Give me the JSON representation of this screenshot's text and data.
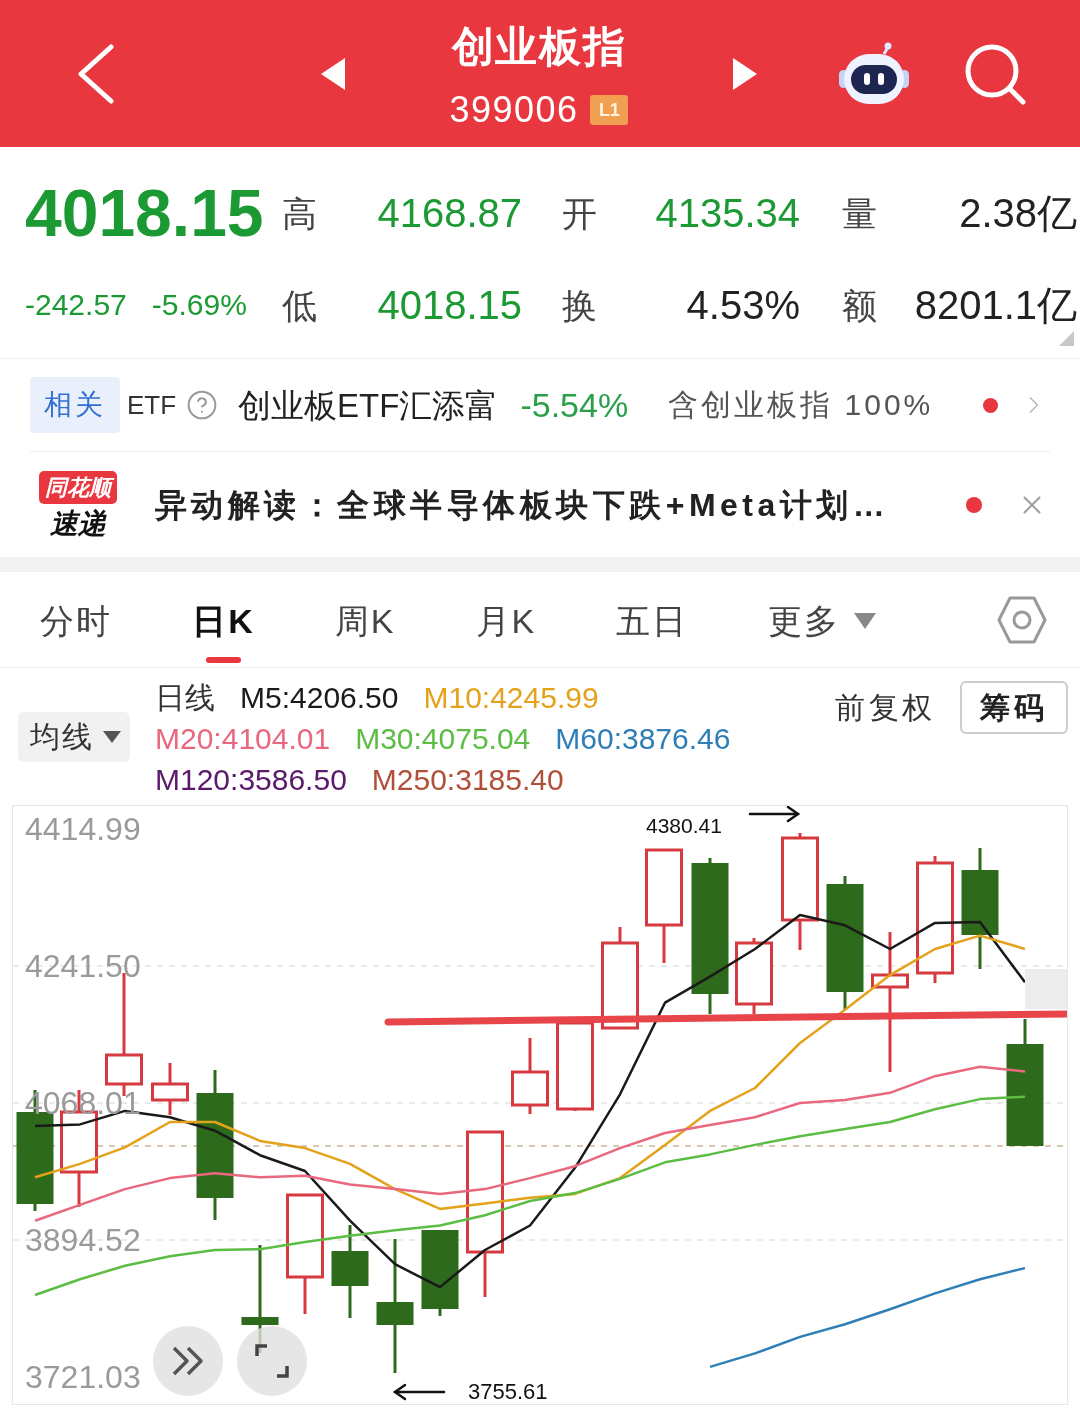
{
  "header": {
    "title": "创业板指",
    "code": "399006",
    "level_badge": "L1"
  },
  "quote": {
    "falling": true,
    "price": "4018.15",
    "change": "-242.57",
    "change_percent": "-5.69%",
    "stats": [
      {
        "label": "高",
        "value": "4168.87",
        "color": "#1b9a33"
      },
      {
        "label": "开",
        "value": "4135.34",
        "color": "#1b9a33"
      },
      {
        "label": "量",
        "value": "2.38亿",
        "color": "#222222"
      },
      {
        "label": "低",
        "value": "4018.15",
        "color": "#1b9a33"
      },
      {
        "label": "换",
        "value": "4.53%",
        "color": "#222222"
      },
      {
        "label": "额",
        "value": "8201.1亿",
        "color": "#222222"
      }
    ]
  },
  "etf": {
    "tag": "相关",
    "label": "ETF",
    "fund": "创业板ETF汇添富",
    "fund_change": "-5.54%",
    "fund_falling": true,
    "holding": "含创业板指 100%",
    "new": true
  },
  "news": {
    "logo_top": "同花顺",
    "logo_bottom": "速递",
    "text": "异动解读：全球半导体板块下跌+Meta计划…",
    "new": true
  },
  "tabs": [
    {
      "label": "分时",
      "selected": false,
      "kind": "tab"
    },
    {
      "label": "日K",
      "selected": true,
      "kind": "tab"
    },
    {
      "label": "周K",
      "selected": false,
      "kind": "tab"
    },
    {
      "label": "月K",
      "selected": false,
      "kind": "tab"
    },
    {
      "label": "五日",
      "selected": false,
      "kind": "tab"
    },
    {
      "label": "更多",
      "selected": false,
      "kind": "dropdown"
    }
  ],
  "indicator": {
    "button": "均线",
    "period": "日线",
    "rows": [
      [
        {
          "label": "M5:4206.50",
          "color": "#1a1a1a"
        },
        {
          "label": "M10:4245.99",
          "color": "#e3a21a"
        }
      ],
      [
        {
          "label": "M20:4104.01",
          "color": "#e8687f"
        },
        {
          "label": "M30:4075.04",
          "color": "#5cbd45"
        },
        {
          "label": "M60:3876.46",
          "color": "#2f7fb6"
        }
      ],
      [
        {
          "label": "M120:3586.50",
          "color": "#5a1a6a"
        },
        {
          "label": "M250:3185.40",
          "color": "#b0503a"
        }
      ]
    ],
    "adjust": "前复权",
    "chips_button": "筹码"
  },
  "chart": {
    "high_label": "4380.41",
    "low_label": "3755.61",
    "chart_data": {
      "type": "line",
      "ylim": [
        3687,
        4444
      ],
      "yticks": [
        {
          "value": 4414.99,
          "label": "4414.99"
        },
        {
          "value": 4241.5,
          "label": "4241.50"
        },
        {
          "value": 4068.01,
          "label": "4068.01"
        },
        {
          "value": 3894.52,
          "label": "3894.52"
        },
        {
          "value": 3721.03,
          "label": "3721.03"
        }
      ],
      "grid": true,
      "series": [
        {
          "color": "#1a1a1a",
          "values": [
            4039,
            4041,
            4058,
            4050,
            4033,
            4002,
            3982,
            3919,
            3864,
            3835,
            3882,
            3913,
            3986,
            4079,
            4195,
            4228,
            4263,
            4306,
            4293,
            4263,
            4296,
            4297,
            4221
          ]
        },
        {
          "color": "#e3a21a",
          "values": [
            3974,
            3991,
            4012,
            4044,
            4044,
            4020,
            4011,
            3991,
            3959,
            3934,
            3941,
            3948,
            3953,
            3973,
            4015,
            4058,
            4087,
            4144,
            4186,
            4230,
            4263,
            4280,
            4263
          ]
        },
        {
          "color": "#e8687f",
          "values": [
            3919,
            3939,
            3959,
            3973,
            3979,
            3974,
            3976,
            3965,
            3959,
            3953,
            3959,
            3973,
            3988,
            4011,
            4030,
            4040,
            4050,
            4068,
            4072,
            4081,
            4102,
            4114,
            4108
          ]
        },
        {
          "color": "#5cbd45",
          "values": [
            3825,
            3845,
            3862,
            3874,
            3882,
            3883,
            3892,
            3900,
            3907,
            3913,
            3926,
            3944,
            3954,
            3972,
            3993,
            4003,
            4015,
            4026,
            4035,
            4044,
            4060,
            4073,
            4076
          ]
        },
        {
          "color": "#2f7fb6",
          "values": [
            null,
            null,
            null,
            null,
            null,
            null,
            null,
            null,
            null,
            null,
            null,
            null,
            null,
            null,
            null,
            3734,
            3751,
            3772,
            3788,
            3807,
            3827,
            3845,
            3859
          ]
        }
      ]
    }
  }
}
